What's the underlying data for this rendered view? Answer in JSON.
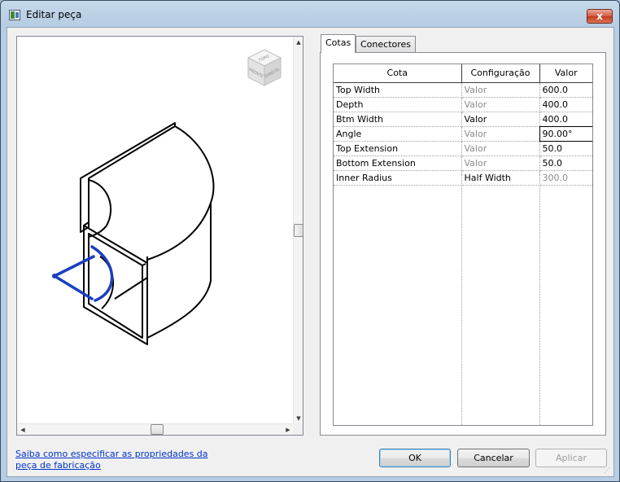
{
  "window": {
    "title": "Editar peça",
    "close_glyph": "x"
  },
  "preview": {
    "viewcube_labels": [
      "TOPO",
      "FRENTE",
      "DIREITA"
    ]
  },
  "tabs": [
    {
      "label": "Cotas",
      "active": true
    },
    {
      "label": "Conectores",
      "active": false
    }
  ],
  "table": {
    "headers": [
      "Cota",
      "Configuração",
      "Valor"
    ],
    "rows": [
      {
        "cota": "Top Width",
        "config": "Valor",
        "valor": "600.0"
      },
      {
        "cota": "Depth",
        "config": "Valor",
        "valor": "400.0"
      },
      {
        "cota": "Btm Width",
        "config": "Valor",
        "valor": "400.0"
      },
      {
        "cota": "Angle",
        "config": "Valor",
        "valor": "90.00°"
      },
      {
        "cota": "Top Extension",
        "config": "Valor",
        "valor": "50.0"
      },
      {
        "cota": "Bottom Extension",
        "config": "Valor",
        "valor": "50.0"
      },
      {
        "cota": "Inner Radius",
        "config": "Half Width",
        "valor": "300.0"
      }
    ]
  },
  "help_link": "Saiba como especificar as propriedades da peça de fabricação",
  "buttons": {
    "ok": "OK",
    "cancel": "Cancelar",
    "apply": "Aplicar"
  },
  "colors": {
    "accent_blue": "#1a3fbf",
    "link": "#0033cc"
  }
}
